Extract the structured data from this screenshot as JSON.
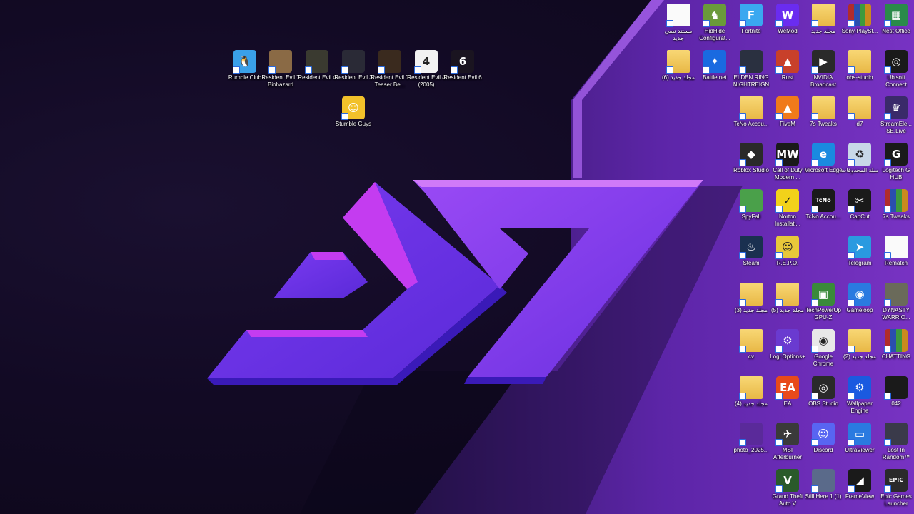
{
  "desktop": {
    "colors": {
      "bg_dark": "#120a24",
      "accent_purple": "#9b3df0",
      "accent_magenta": "#c43cf0",
      "accent_blue": "#4a2bd8"
    },
    "wallpaper_logo": "d7",
    "top_left_icons": [
      {
        "label": "Rumble Club",
        "icon": "rumble-club-icon",
        "glyph": "🐧",
        "bg": "#3aa0e8"
      },
      {
        "label": "Resident Evil 7 Biohazard",
        "icon": "resident-evil-7-icon",
        "glyph": "",
        "bg": "#8a6a45"
      },
      {
        "label": "Resident Evil 4",
        "icon": "resident-evil-4-icon",
        "glyph": "",
        "bg": "#3a3a30"
      },
      {
        "label": "Resident Evil 3",
        "icon": "resident-evil-3-icon",
        "glyph": "",
        "bg": "#2a2a36"
      },
      {
        "label": "Resident Evil 7 Teaser Be...",
        "icon": "resident-evil-7-teaser-icon",
        "glyph": "",
        "bg": "#3a2a1e"
      },
      {
        "label": "Resident Evil 4 (2005)",
        "icon": "resident-evil-4-2005-icon",
        "glyph": "4",
        "bg": "#f2f2f2"
      },
      {
        "label": "Resident Evil 6",
        "icon": "resident-evil-6-icon",
        "glyph": "6",
        "bg": "#1a1420"
      },
      {
        "label": "Stumble Guys",
        "icon": "stumble-guys-icon",
        "glyph": "☺",
        "bg": "#f2c12a"
      }
    ],
    "right_grid": [
      [
        {
          "label": "مستند نصي جديد",
          "icon": "text-document-icon",
          "glyph": "",
          "bg": "doc"
        },
        {
          "label": "HidHide Configurat...",
          "icon": "hidhide-icon",
          "glyph": "♞",
          "bg": "#6a9a3a"
        },
        {
          "label": "Fortnite",
          "icon": "fortnite-icon",
          "glyph": "F",
          "bg": "#3aa8f0"
        },
        {
          "label": "WeMod",
          "icon": "wemod-icon",
          "glyph": "W",
          "bg": "#6a2cf0"
        },
        {
          "label": "مجلد جديد",
          "icon": "folder-icon",
          "glyph": "",
          "bg": "folder"
        },
        {
          "label": "Sony-PlaySt...",
          "icon": "winrar-archive-icon",
          "glyph": "",
          "bg": "rar"
        },
        {
          "label": "Nest Office",
          "icon": "nest-office-icon",
          "glyph": "▦",
          "bg": "#2a8a4a"
        }
      ],
      [
        {
          "label": "مجلد جديد (6)",
          "icon": "folder-icon",
          "glyph": "",
          "bg": "folder"
        },
        {
          "label": "Battle.net",
          "icon": "battle-net-icon",
          "glyph": "✦",
          "bg": "#1a6ae0"
        },
        {
          "label": "ELDEN RING NIGHTREIGN",
          "icon": "elden-ring-icon",
          "glyph": "",
          "bg": "#2a3040"
        },
        {
          "label": "Rust",
          "icon": "rust-icon",
          "glyph": "▲",
          "bg": "#c8402a"
        },
        {
          "label": "NVIDIA Broadcast",
          "icon": "nvidia-broadcast-icon",
          "glyph": "▶",
          "bg": "#2a2a2a"
        },
        {
          "label": "obs-studio",
          "icon": "folder-icon",
          "glyph": "",
          "bg": "folder"
        },
        {
          "label": "Ubisoft Connect",
          "icon": "ubisoft-connect-icon",
          "glyph": "◎",
          "bg": "#1a1a1a"
        }
      ],
      [
        {
          "label": "TcNo Accou...",
          "icon": "folder-icon",
          "glyph": "",
          "bg": "folder"
        },
        {
          "label": "FiveM",
          "icon": "fivem-icon",
          "glyph": "▲",
          "bg": "#f07a1a"
        },
        {
          "label": "7s Tweaks",
          "icon": "folder-icon",
          "glyph": "",
          "bg": "folder"
        },
        {
          "label": "d7",
          "icon": "folder-icon",
          "glyph": "",
          "bg": "folder"
        },
        {
          "label": "StreamEle... SE.Live",
          "icon": "streamelements-icon",
          "glyph": "♛",
          "bg": "#3a2a6a"
        }
      ],
      [
        {
          "label": "Roblox Studio",
          "icon": "roblox-studio-icon",
          "glyph": "◆",
          "bg": "#2a2a2a"
        },
        {
          "label": "Call of Duty Modern ...",
          "icon": "call-of-duty-icon",
          "glyph": "MW",
          "bg": "#1a1a1a"
        },
        {
          "label": "Microsoft Edge",
          "icon": "microsoft-edge-icon",
          "glyph": "e",
          "bg": "#1a8ae0"
        },
        {
          "label": "سلة المحذوفات",
          "icon": "recycle-bin-icon",
          "glyph": "♻",
          "bg": "#c8d8e8"
        },
        {
          "label": "Logitech G HUB",
          "icon": "logitech-g-hub-icon",
          "glyph": "G",
          "bg": "#1a1a1a"
        }
      ],
      [
        {
          "label": "SpyFall",
          "icon": "spyfall-icon",
          "glyph": "",
          "bg": "#4aa04a"
        },
        {
          "label": "Norton Installati...",
          "icon": "norton-icon",
          "glyph": "✓",
          "bg": "#f2d21a"
        },
        {
          "label": "TcNo Accou...",
          "icon": "tcno-icon",
          "glyph": "TcNo",
          "bg": "#1a1a1a"
        },
        {
          "label": "CapCut",
          "icon": "capcut-icon",
          "glyph": "✂",
          "bg": "#1a1a1a"
        },
        {
          "label": "7s Tweaks",
          "icon": "winrar-archive-icon",
          "glyph": "",
          "bg": "rar"
        }
      ],
      [
        {
          "label": "Steam",
          "icon": "steam-icon",
          "glyph": "♨",
          "bg": "#1a3050"
        },
        {
          "label": "R.E.P.O.",
          "icon": "repo-icon",
          "glyph": "☺",
          "bg": "#e8c83a"
        },
        {
          "label": "Telegram",
          "icon": "telegram-icon",
          "glyph": "➤",
          "bg": "#2a9ae0"
        },
        {
          "label": "Rematch",
          "icon": "text-document-icon",
          "glyph": "",
          "bg": "doc"
        }
      ],
      [
        {
          "label": "مجلد جديد (3)",
          "icon": "folder-icon",
          "glyph": "",
          "bg": "folder"
        },
        {
          "label": "مجلد جديد (5)",
          "icon": "folder-icon",
          "glyph": "",
          "bg": "folder"
        },
        {
          "label": "TechPowerUp GPU-Z",
          "icon": "gpu-z-icon",
          "glyph": "▣",
          "bg": "#3a8a3a"
        },
        {
          "label": "Gameloop",
          "icon": "gameloop-icon",
          "glyph": "◉",
          "bg": "#2a7ae0"
        },
        {
          "label": "DYNASTY WARRIO...",
          "icon": "dynasty-warriors-icon",
          "glyph": "",
          "bg": "#6a6a5a"
        }
      ],
      [
        {
          "label": "cv",
          "icon": "folder-icon",
          "glyph": "",
          "bg": "folder"
        },
        {
          "label": "Logi Options+",
          "icon": "logi-options-icon",
          "glyph": "⚙",
          "bg": "#6a3ad0"
        },
        {
          "label": "Google Chrome",
          "icon": "google-chrome-icon",
          "glyph": "◉",
          "bg": "#e8e8e8"
        },
        {
          "label": "مجلد جديد (2)",
          "icon": "folder-icon",
          "glyph": "",
          "bg": "folder"
        },
        {
          "label": "CHATTING",
          "icon": "winrar-archive-icon",
          "glyph": "",
          "bg": "rar"
        }
      ],
      [
        {
          "label": "مجلد جديد (4)",
          "icon": "folder-icon",
          "glyph": "",
          "bg": "folder"
        },
        {
          "label": "EA",
          "icon": "ea-icon",
          "glyph": "EA",
          "bg": "#e84a1a"
        },
        {
          "label": "OBS Studio",
          "icon": "obs-studio-icon",
          "glyph": "◎",
          "bg": "#2a2a2a"
        },
        {
          "label": "Wallpaper Engine",
          "icon": "wallpaper-engine-icon",
          "glyph": "⚙",
          "bg": "#1a5ae0"
        },
        {
          "label": "042",
          "icon": "image-file-icon",
          "glyph": "",
          "bg": "#1a1a1a"
        }
      ],
      [
        {
          "label": "photo_2025...",
          "icon": "image-file-icon",
          "glyph": "",
          "bg": "#5a2a9a"
        },
        {
          "label": "MSI Afterburner",
          "icon": "msi-afterburner-icon",
          "glyph": "✈",
          "bg": "#3a3a3a"
        },
        {
          "label": "Discord",
          "icon": "discord-icon",
          "glyph": "☺",
          "bg": "#5865f2"
        },
        {
          "label": "UltraViewer",
          "icon": "ultraviewer-icon",
          "glyph": "▭",
          "bg": "#2a7ae0"
        },
        {
          "label": "Lost In Random™",
          "icon": "lost-in-random-icon",
          "glyph": "",
          "bg": "#3a3a4a"
        }
      ],
      [
        {
          "label": "Grand Theft Auto V",
          "icon": "gta-v-icon",
          "glyph": "V",
          "bg": "#2a5a2a"
        },
        {
          "label": "Still Here 1 (1)",
          "icon": "image-file-icon",
          "glyph": "",
          "bg": "#5a6a8a"
        },
        {
          "label": "FrameView",
          "icon": "frameview-icon",
          "glyph": "◢",
          "bg": "#1a1a1a"
        },
        {
          "label": "Epic Games Launcher",
          "icon": "epic-games-icon",
          "glyph": "EPIC",
          "bg": "#2a2a2a"
        }
      ]
    ]
  }
}
